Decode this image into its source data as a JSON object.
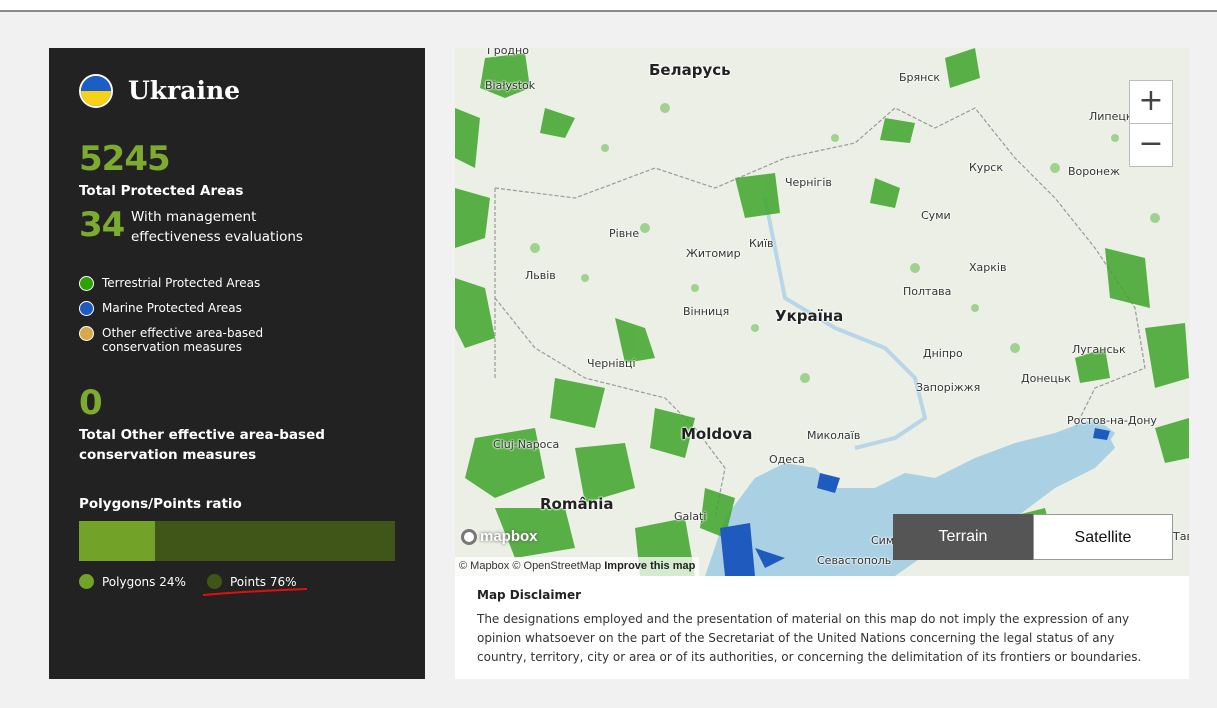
{
  "country": {
    "name": "Ukraine",
    "flag_colors": [
      "#1a5fc6",
      "#f7d117"
    ]
  },
  "stats": {
    "total_pa_value": "5245",
    "total_pa_label": "Total Protected Areas",
    "mgmt_value": "34",
    "mgmt_label": "With management effectiveness evaluations",
    "oecm_value": "0",
    "oecm_label": "Total Other effective area-based conservation measures"
  },
  "legend": [
    {
      "label": "Terrestrial Protected Areas",
      "color": "#2ea300"
    },
    {
      "label": "Marine Protected Areas",
      "color": "#1f5bbf"
    },
    {
      "label": "Other effective area-based conservation measures",
      "color": "#d9a84a"
    }
  ],
  "ratio": {
    "title": "Polygons/Points ratio",
    "polygons_fraction": 0.24,
    "polygons_label": "Polygons 24%",
    "points_label": "Points 76%",
    "polygons_color": "#72a228",
    "points_color": "#405518"
  },
  "map": {
    "places": [
      {
        "name": "Беларусь",
        "big": true
      },
      {
        "name": "Україна",
        "big": true
      },
      {
        "name": "Moldova",
        "big": true
      },
      {
        "name": "România",
        "big": true
      },
      {
        "name": "Białystok"
      },
      {
        "name": "Гродно"
      },
      {
        "name": "Брянск"
      },
      {
        "name": "Липецк"
      },
      {
        "name": "Курск"
      },
      {
        "name": "Воронеж"
      },
      {
        "name": "Чернігів"
      },
      {
        "name": "Суми"
      },
      {
        "name": "Рівне"
      },
      {
        "name": "Житомир"
      },
      {
        "name": "Київ"
      },
      {
        "name": "Харків"
      },
      {
        "name": "Львів"
      },
      {
        "name": "Полтава"
      },
      {
        "name": "Вінниця"
      },
      {
        "name": "Луганськ"
      },
      {
        "name": "Дніпро"
      },
      {
        "name": "Запоріжжя"
      },
      {
        "name": "Донецьк"
      },
      {
        "name": "Чернівці"
      },
      {
        "name": "Ростов-на-Дону"
      },
      {
        "name": "Cluj-Napoca"
      },
      {
        "name": "Миколаїв"
      },
      {
        "name": "Одеса"
      },
      {
        "name": "Galați"
      },
      {
        "name": "Сим"
      },
      {
        "name": "Севастополь"
      },
      {
        "name": "Tав"
      }
    ],
    "zoom_in": "+",
    "zoom_out": "−",
    "terrain_label": "Terrain",
    "satellite_label": "Satellite",
    "mapbox_logo": "mapbox",
    "attribution_1": "© Mapbox © OpenStreetMap",
    "attribution_2": "Improve this map",
    "land_color": "#ecefe6",
    "pa_color": "#3fa52a",
    "sea_color": "#a9d0e3"
  },
  "disclaimer": {
    "title": "Map Disclaimer",
    "body": "The designations employed and the presentation of material on this map do not imply the expression of any opinion whatsoever on the part of the Secretariat of the United Nations concerning the legal status of any country, territory, city or area or of its authorities, or concerning the delimitation of its frontiers or boundaries."
  }
}
